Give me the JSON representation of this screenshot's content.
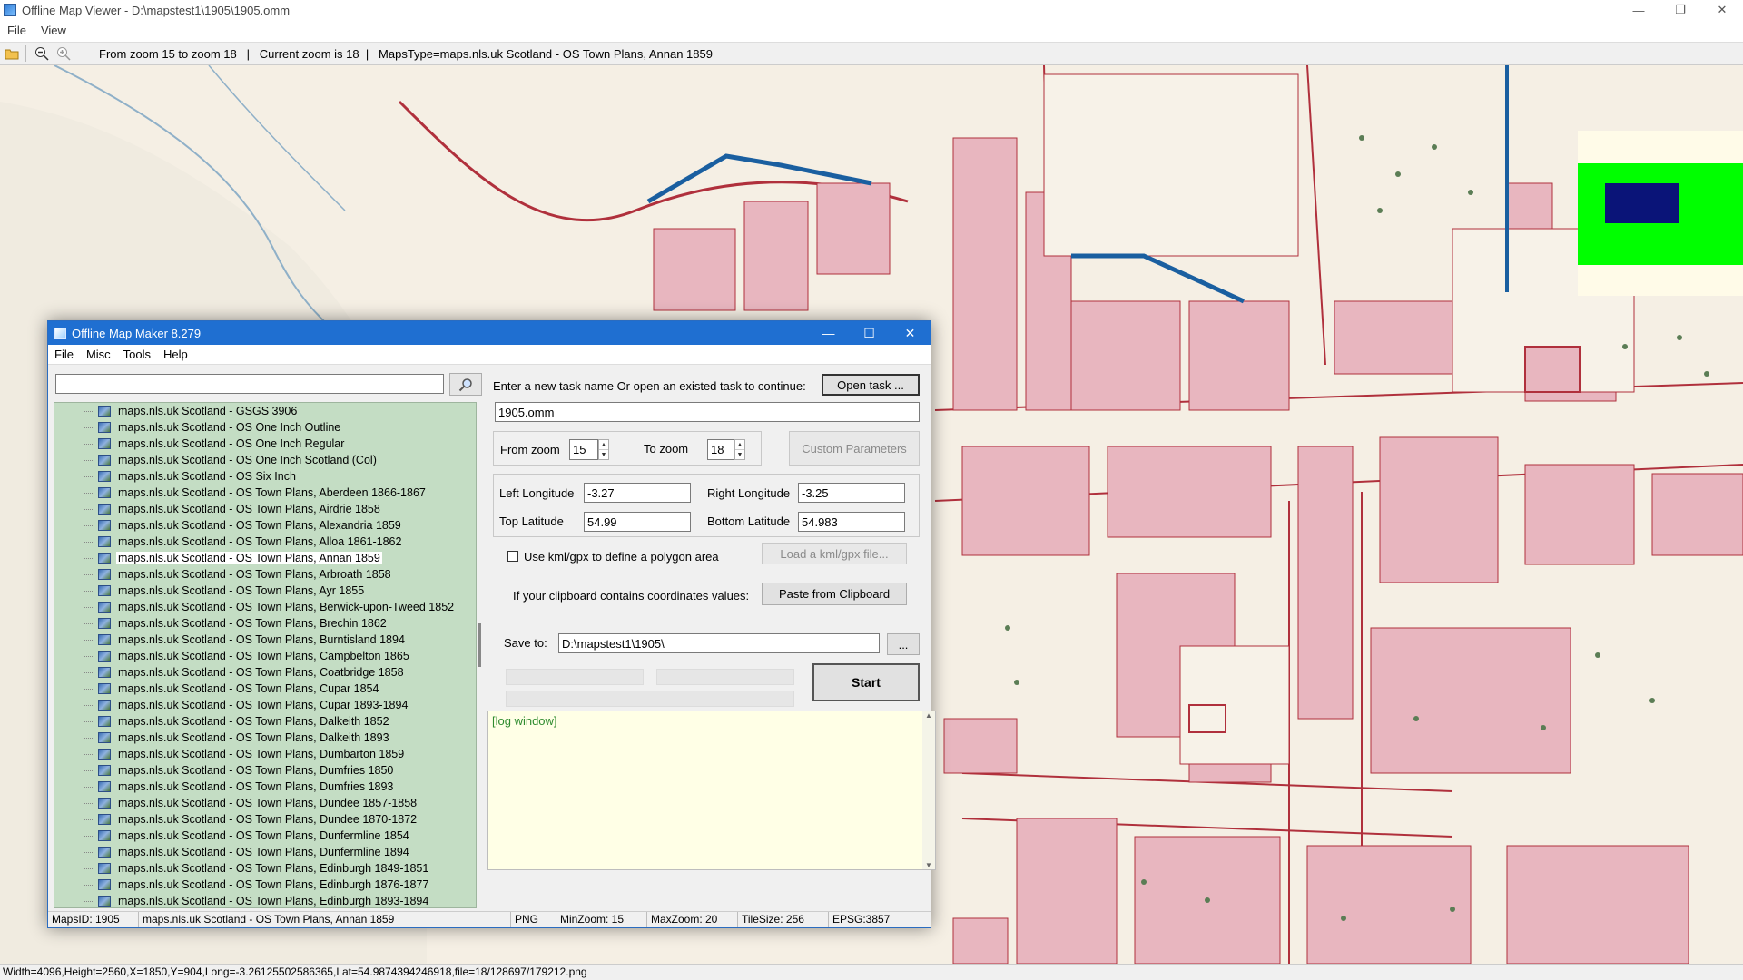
{
  "viewer": {
    "title": "Offline Map Viewer - D:\\mapstest1\\1905\\1905.omm",
    "menu": [
      "File",
      "View"
    ],
    "toolbar": {
      "open_icon": "folder-open-icon",
      "zoom_out_icon": "zoom-out-icon",
      "zoom_in_icon": "zoom-in-icon",
      "info": "From zoom 15 to zoom 18   |   Current zoom is 18  |   MapsType=maps.nls.uk Scotland - OS Town Plans, Annan 1859"
    },
    "status": "Width=4096,Height=2560,X=1850,Y=904,Long=-3.26125502586365,Lat=54.9874394246918,file=18/128697/179212.png",
    "window_controls": [
      "—",
      "❐",
      "✕"
    ]
  },
  "maker": {
    "title": "Offline Map Maker 8.279",
    "menu": [
      "File",
      "Misc",
      "Tools",
      "Help"
    ],
    "window_controls": [
      "—",
      "☐",
      "✕"
    ],
    "search": {
      "value": "",
      "icon": "search-icon"
    },
    "tree_items": [
      "maps.nls.uk Scotland - GSGS 3906",
      "maps.nls.uk Scotland - OS One Inch Outline",
      "maps.nls.uk Scotland - OS One Inch Regular",
      "maps.nls.uk Scotland - OS One Inch Scotland (Col)",
      "maps.nls.uk Scotland - OS Six Inch",
      "maps.nls.uk Scotland - OS Town Plans, Aberdeen 1866-1867",
      "maps.nls.uk Scotland - OS Town Plans, Airdrie 1858",
      "maps.nls.uk Scotland - OS Town Plans, Alexandria 1859",
      "maps.nls.uk Scotland - OS Town Plans, Alloa 1861-1862",
      "maps.nls.uk Scotland - OS Town Plans, Annan 1859",
      "maps.nls.uk Scotland - OS Town Plans, Arbroath 1858",
      "maps.nls.uk Scotland - OS Town Plans, Ayr 1855",
      "maps.nls.uk Scotland - OS Town Plans, Berwick-upon-Tweed 1852",
      "maps.nls.uk Scotland - OS Town Plans, Brechin 1862",
      "maps.nls.uk Scotland - OS Town Plans, Burntisland 1894",
      "maps.nls.uk Scotland - OS Town Plans, Campbelton 1865",
      "maps.nls.uk Scotland - OS Town Plans, Coatbridge 1858",
      "maps.nls.uk Scotland - OS Town Plans, Cupar 1854",
      "maps.nls.uk Scotland - OS Town Plans, Cupar 1893-1894",
      "maps.nls.uk Scotland - OS Town Plans, Dalkeith 1852",
      "maps.nls.uk Scotland - OS Town Plans, Dalkeith 1893",
      "maps.nls.uk Scotland - OS Town Plans, Dumbarton 1859",
      "maps.nls.uk Scotland - OS Town Plans, Dumfries 1850",
      "maps.nls.uk Scotland - OS Town Plans, Dumfries 1893",
      "maps.nls.uk Scotland - OS Town Plans, Dundee 1857-1858",
      "maps.nls.uk Scotland - OS Town Plans, Dundee 1870-1872",
      "maps.nls.uk Scotland - OS Town Plans, Dunfermline 1854",
      "maps.nls.uk Scotland - OS Town Plans, Dunfermline 1894",
      "maps.nls.uk Scotland - OS Town Plans, Edinburgh 1849-1851",
      "maps.nls.uk Scotland - OS Town Plans, Edinburgh 1876-1877",
      "maps.nls.uk Scotland - OS Town Plans, Edinburgh 1893-1894"
    ],
    "selected_index": 9,
    "task_prompt": "Enter a new task name Or open an existed task to continue:",
    "open_task_label": "Open task ...",
    "task_name": "1905.omm",
    "from_zoom_label": "From zoom",
    "from_zoom": "15",
    "to_zoom_label": "To zoom",
    "to_zoom": "18",
    "custom_params_label": "Custom Parameters",
    "left_lon_label": "Left Longitude",
    "left_lon": "-3.27",
    "right_lon_label": "Right Longitude",
    "right_lon": "-3.25",
    "top_lat_label": "Top Latitude",
    "top_lat": "54.99",
    "bottom_lat_label": "Bottom Latitude",
    "bottom_lat": "54.983",
    "kml_label": "Use kml/gpx to define a polygon area",
    "load_kml_label": "Load a kml/gpx file...",
    "clipboard_prompt": "If your clipboard contains coordinates values:",
    "paste_label": "Paste from Clipboard",
    "save_to_label": "Save to:",
    "save_to": "D:\\mapstest1\\1905\\",
    "browse_label": "...",
    "start_label": "Start",
    "log_text": "[log window]",
    "status": {
      "maps_id": "MapsID: 1905",
      "map_name": "maps.nls.uk Scotland - OS Town Plans, Annan 1859",
      "format": "PNG",
      "min_zoom": "MinZoom: 15",
      "max_zoom": "MaxZoom: 20",
      "tile_size": "TileSize: 256",
      "epsg": "EPSG:3857"
    }
  },
  "colors": {
    "map_paper": "#f5efe4",
    "building_pink": "#e8b6bf",
    "road_red": "#b0303c",
    "river_blue": "#1a5fa0",
    "tree_bg": "#c4ddc4",
    "overview_green": "#00ff00",
    "overview_navy": "#0a1478",
    "log_bg": "#ffffe6"
  }
}
